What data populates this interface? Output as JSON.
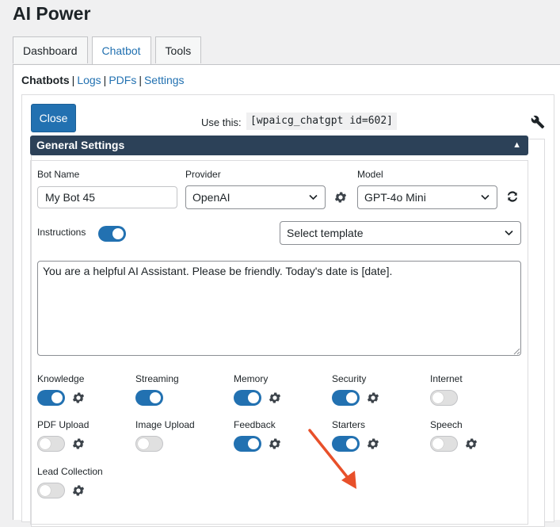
{
  "app": {
    "title": "AI Power"
  },
  "tabs": [
    {
      "label": "Dashboard",
      "active": false
    },
    {
      "label": "Chatbot",
      "active": true
    },
    {
      "label": "Tools",
      "active": false
    }
  ],
  "subnav": {
    "current": "Chatbots",
    "links": [
      "Logs",
      "PDFs",
      "Settings"
    ],
    "separator": "|"
  },
  "toolbar": {
    "close_label": "Close",
    "use_this_label": "Use this:",
    "shortcode": "[wpaicg_chatgpt id=602]",
    "wrench_icon": "wrench-icon"
  },
  "panel": {
    "title": "General Settings",
    "caret": "▲"
  },
  "form": {
    "bot_name": {
      "label": "Bot Name",
      "value": "My Bot 45"
    },
    "provider": {
      "label": "Provider",
      "value": "OpenAI"
    },
    "model": {
      "label": "Model",
      "value": "GPT-4o Mini"
    },
    "instructions": {
      "label": "Instructions",
      "on": true
    },
    "template": {
      "value": "Select template"
    },
    "prompt": "You are a helpful AI Assistant. Please be friendly. Today's date is [date]."
  },
  "features": [
    {
      "label": "Knowledge",
      "on": true,
      "gear": true
    },
    {
      "label": "Streaming",
      "on": true,
      "gear": false
    },
    {
      "label": "Memory",
      "on": true,
      "gear": true
    },
    {
      "label": "Security",
      "on": true,
      "gear": true
    },
    {
      "label": "Internet",
      "on": false,
      "gear": false
    },
    {
      "label": "PDF Upload",
      "on": false,
      "gear": true
    },
    {
      "label": "Image Upload",
      "on": false,
      "gear": false
    },
    {
      "label": "Feedback",
      "on": true,
      "gear": true
    },
    {
      "label": "Starters",
      "on": true,
      "gear": true
    },
    {
      "label": "Speech",
      "on": false,
      "gear": true
    },
    {
      "label": "Lead Collection",
      "on": false,
      "gear": true
    }
  ],
  "colors": {
    "accent": "#2271b1",
    "panel_header": "#2c4158",
    "annotation_arrow": "#e8502a",
    "toggle_off": "#e0e0e0"
  }
}
